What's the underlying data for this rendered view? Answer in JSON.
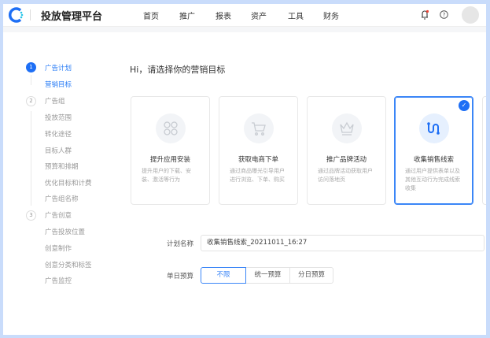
{
  "header": {
    "title": "投放管理平台",
    "nav": [
      "首页",
      "推广",
      "报表",
      "资产",
      "工具",
      "财务"
    ],
    "icons": [
      "bell-icon",
      "help-icon",
      "avatar"
    ]
  },
  "sidebar": {
    "steps": [
      {
        "num": "1",
        "label": "广告计划",
        "items": [
          "营销目标"
        ]
      },
      {
        "num": "2",
        "label": "广告组",
        "items": [
          "投放范围",
          "转化途径",
          "目标人群",
          "预算和排期",
          "优化目标和计费",
          "广告组名称"
        ]
      },
      {
        "num": "3",
        "label": "广告创意",
        "items": [
          "广告投放位置",
          "创意制作",
          "创意分类和标签",
          "广告监控"
        ]
      }
    ]
  },
  "main": {
    "heading": "Hi，请选择你的营销目标",
    "cards": [
      {
        "title": "提升应用安装",
        "desc": "提升用户的下载、安装、激活等行为",
        "icon": "apps-icon",
        "selected": false
      },
      {
        "title": "获取电商下单",
        "desc": "通过商品曝光引导用户进行浏览、下单、购买",
        "icon": "cart-icon",
        "selected": false
      },
      {
        "title": "推广品牌活动",
        "desc": "通过品牌活动获取用户访问落地页",
        "icon": "crown-icon",
        "selected": false
      },
      {
        "title": "收集销售线索",
        "desc": "通过用户提供表单以及其他互动行为完成线索收集",
        "icon": "path-icon",
        "selected": true
      }
    ],
    "plan_name_label": "计划名称",
    "plan_name_value": "收集销售线索_20211011_16:27",
    "budget_label": "单日预算",
    "budget_options": [
      "不限",
      "统一预算",
      "分日预算"
    ],
    "budget_selected": "不限"
  },
  "colors": {
    "accent": "#1e6ff5",
    "frame": "#c9dcfb"
  }
}
